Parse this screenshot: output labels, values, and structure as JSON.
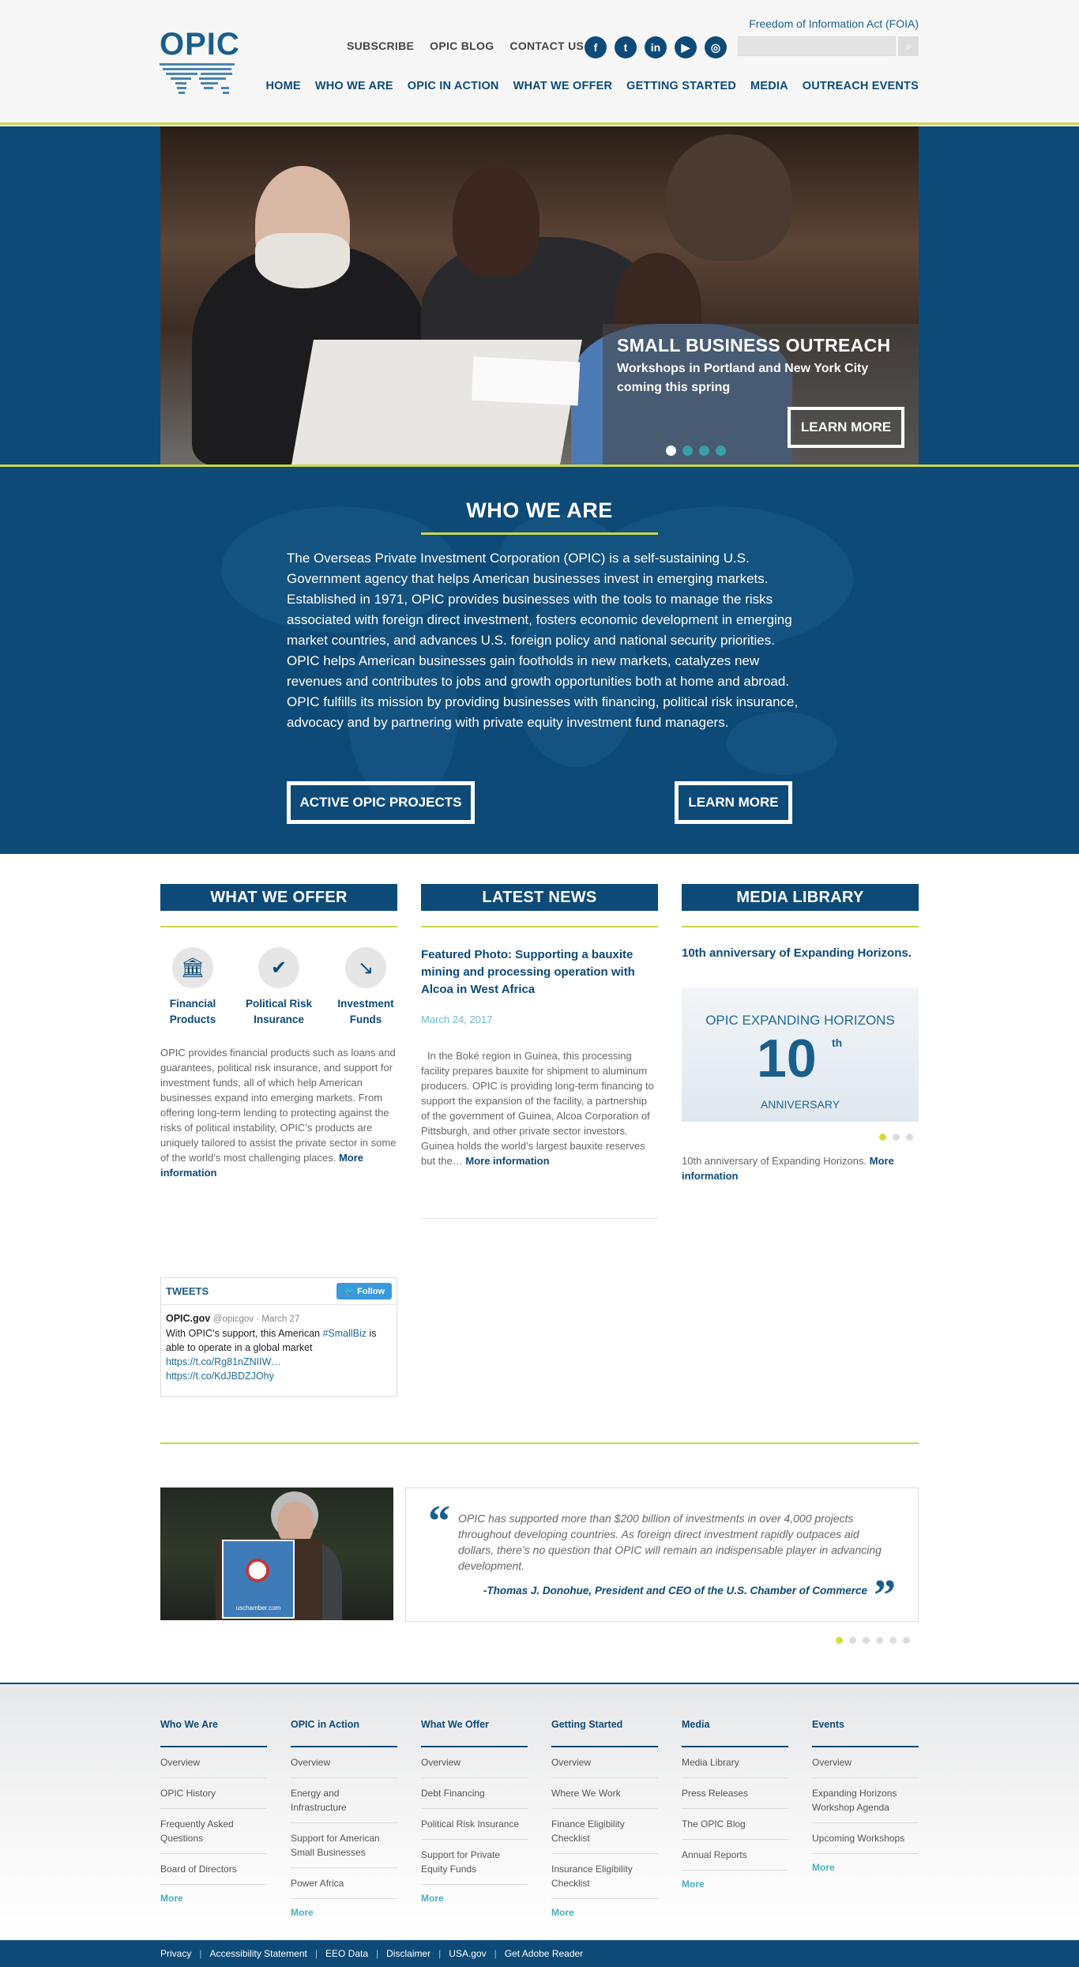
{
  "header": {
    "logo_text": "OPIC",
    "foia": "Freedom of Information Act (FOIA)",
    "util_links": [
      "SUBSCRIBE",
      "OPIC BLOG",
      "CONTACT US"
    ],
    "social": [
      {
        "icon": "facebook-icon",
        "glyph": "f"
      },
      {
        "icon": "twitter-icon",
        "glyph": "t"
      },
      {
        "icon": "linkedin-icon",
        "glyph": "in"
      },
      {
        "icon": "youtube-icon",
        "glyph": "▶"
      },
      {
        "icon": "instagram-icon",
        "glyph": "◎"
      }
    ],
    "search_placeholder": "",
    "search_icon": "⌕",
    "nav": [
      "HOME",
      "WHO WE ARE",
      "OPIC IN ACTION",
      "WHAT WE OFFER",
      "GETTING STARTED",
      "MEDIA",
      "OUTREACH EVENTS"
    ]
  },
  "hero": {
    "title": "SMALL BUSINESS OUTREACH",
    "subtitle": "Workshops in Portland and New York City coming this spring",
    "button": "LEARN MORE",
    "slides": 4,
    "active_slide": 0
  },
  "who": {
    "title": "WHO WE ARE",
    "body": "The Overseas Private Investment Corporation (OPIC) is a self-sustaining U.S. Government agency that helps American businesses invest in emerging markets. Established in 1971, OPIC provides businesses with the tools to manage the risks associated with foreign direct investment, fosters economic development in emerging market countries, and advances U.S. foreign policy and national security priorities. OPIC helps American businesses gain footholds in new markets, catalyzes new revenues and contributes to jobs and growth opportunities both at home and abroad. OPIC fulfills its mission by providing businesses with financing, political risk insurance, advocacy and by partnering with private equity investment fund managers.",
    "btn_projects": "ACTIVE OPIC PROJECTS",
    "btn_learn": "LEARN MORE"
  },
  "offer": {
    "title": "WHAT WE OFFER",
    "items": [
      {
        "label": "Financial Products",
        "icon": "bank-icon",
        "glyph": "🏛"
      },
      {
        "label": "Political Risk Insurance",
        "icon": "shield-icon",
        "glyph": "✔"
      },
      {
        "label": "Investment Funds",
        "icon": "chart-icon",
        "glyph": "↘"
      }
    ],
    "body": "OPIC provides financial products such as loans and guarantees, political risk insurance, and support for investment funds, all of which help American businesses expand into emerging markets. From offering long-term lending to protecting against the risks of political instability, OPIC’s products are uniquely tailored to assist the private sector in some of the world’s most challenging places.",
    "more": "More information"
  },
  "news": {
    "title": "LATEST NEWS",
    "headline": "Featured Photo: Supporting a bauxite mining and processing operation with Alcoa in West Africa",
    "date": "March 24, 2017",
    "body": "In the Boké region in Guinea, this processing facility prepares bauxite for shipment to aluminum producers. OPIC is providing long-term financing to support the expansion of the facility, a partnership of the government of Guinea, Alcoa Corporation of Pittsburgh, and other private sector investors. Guinea holds the world’s largest bauxite reserves but the…",
    "more": "More information"
  },
  "media": {
    "title": "MEDIA LIBRARY",
    "headline": "10th anniversary of Expanding Horizons.",
    "img_title": "OPIC EXPANDING HORIZONS",
    "img_num": "10",
    "img_sup": "th",
    "img_sub": "ANNIVERSARY",
    "caption": "10th anniversary of Expanding Horizons.",
    "more": "More information",
    "dots": 3,
    "active_dot": 0
  },
  "tweets": {
    "title": "TWEETS",
    "follow": "Follow",
    "follow_icon": "twitter-bird-icon",
    "author": "OPIC.gov",
    "handle": "@opicgov · March 27",
    "text_before": "With OPIC’s support, this American ",
    "hashtag": "#SmallBiz",
    "text_after": " is able to operate in a global market",
    "link1": "https://t.co/Rg81nZNIIW…",
    "link2": "https://t.co/KdJBDZJOhy"
  },
  "quote": {
    "open": "“",
    "close": "”",
    "text": "OPIC has supported more than $200 billion of investments in over 4,000 projects throughout developing countries. As foreign direct investment rapidly outpaces aid dollars, there’s no question that OPIC will remain an indispensable player in advancing development.",
    "author": "-Thomas J. Donohue, President and CEO of the U.S. Chamber of Commerce",
    "podium_text": "uschamber.com",
    "dots": 6,
    "active_dot": 0
  },
  "footer": {
    "columns": [
      {
        "title": "Who We Are",
        "items": [
          "Overview",
          "OPIC History",
          "Frequently Asked Questions",
          "Board of Directors"
        ],
        "more": "More"
      },
      {
        "title": "OPIC in Action",
        "items": [
          "Overview",
          "Energy and Infrastructure",
          "Support for American Small Businesses",
          "Power Africa"
        ],
        "more": "More"
      },
      {
        "title": "What We Offer",
        "items": [
          "Overview",
          "Debt Financing",
          "Political Risk Insurance",
          "Support for Private Equity Funds"
        ],
        "more": "More"
      },
      {
        "title": "Getting Started",
        "items": [
          "Overview",
          "Where We Work",
          "Finance Eligibility Checklist",
          "Insurance Eligibility Checklist"
        ],
        "more": "More"
      },
      {
        "title": "Media",
        "items": [
          "Media Library",
          "Press Releases",
          "The OPIC Blog",
          "Annual Reports"
        ],
        "more": "More"
      },
      {
        "title": "Events",
        "items": [
          "Overview",
          "Expanding Horizons Workshop Agenda",
          "Upcoming Workshops"
        ],
        "more": "More"
      }
    ],
    "legal": [
      "Privacy",
      "Accessibility Statement",
      "EEO Data",
      "Disclaimer",
      "USA.gov",
      "Get Adobe Reader"
    ]
  },
  "colors": {
    "primary": "#0d4a78",
    "accent": "#c9d64a",
    "teal": "#3a9fa8"
  }
}
